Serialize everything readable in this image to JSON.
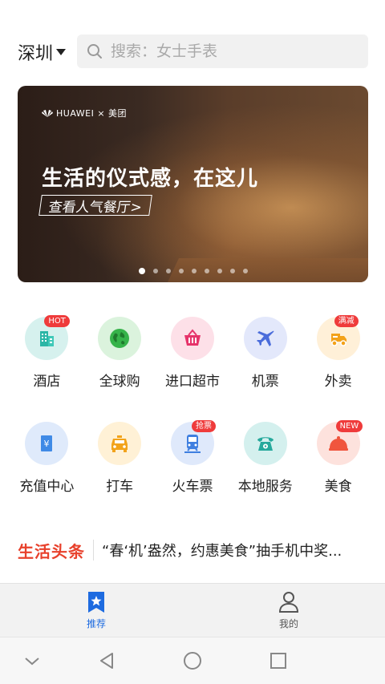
{
  "header": {
    "city": "深圳",
    "search_placeholder": "搜索：女士手表"
  },
  "banner": {
    "brand": "HUAWEI × 美团",
    "headline": "生活的仪式感，在这儿",
    "cta": "查看人气餐厅>",
    "slide_count": 9,
    "active_slide": 1
  },
  "services_row1": [
    {
      "label": "酒店",
      "icon": "hotel-icon",
      "badge": "HOT"
    },
    {
      "label": "全球购",
      "icon": "globe-icon",
      "badge": ""
    },
    {
      "label": "进口超市",
      "icon": "basket-icon",
      "badge": ""
    },
    {
      "label": "机票",
      "icon": "airplane-icon",
      "badge": ""
    },
    {
      "label": "外卖",
      "icon": "delivery-icon",
      "badge": "满减"
    }
  ],
  "services_row2": [
    {
      "label": "充值中心",
      "icon": "recharge-icon",
      "badge": ""
    },
    {
      "label": "打车",
      "icon": "taxi-icon",
      "badge": ""
    },
    {
      "label": "火车票",
      "icon": "train-icon",
      "badge": "抢票"
    },
    {
      "label": "本地服务",
      "icon": "phone-icon",
      "badge": ""
    },
    {
      "label": "美食",
      "icon": "food-cloche-icon",
      "badge": "NEW"
    }
  ],
  "news": {
    "tag": "生活头条",
    "headline": "“春‘机’盎然，约惠美食”抽手机中奖..."
  },
  "tabs": [
    {
      "label": "推荐",
      "icon": "star-bookmark-icon",
      "active": true
    },
    {
      "label": "我的",
      "icon": "person-icon",
      "active": false
    }
  ],
  "system_nav": [
    "chevron-down-icon",
    "back-triangle-icon",
    "home-circle-icon",
    "recents-square-icon"
  ],
  "colors": {
    "accent_blue": "#1e6be0",
    "news_tag_red": "#e8412c",
    "badge_red": "#ef3b3b"
  }
}
